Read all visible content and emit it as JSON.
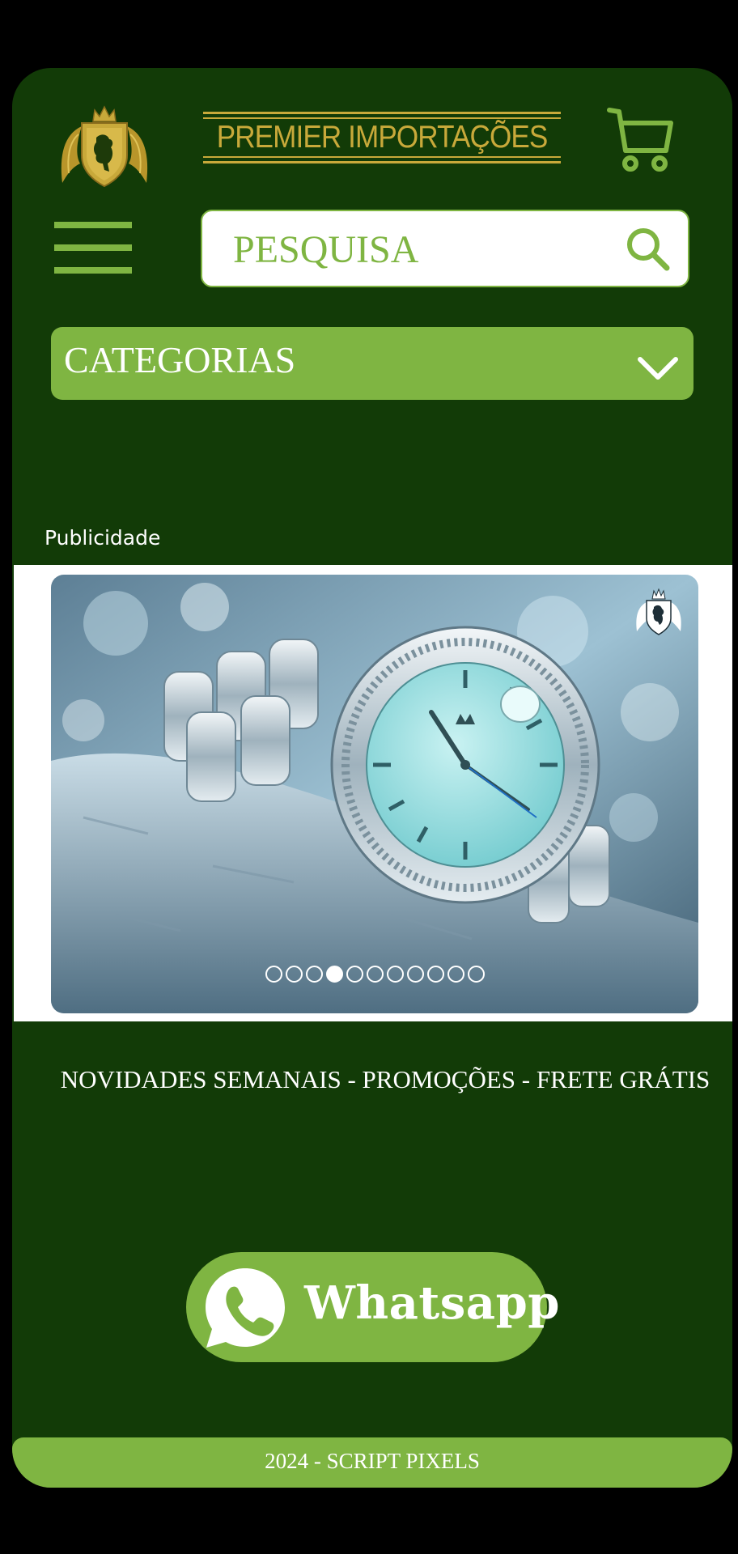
{
  "header": {
    "brand_title": "PREMIER IMPORTAÇÕES"
  },
  "search": {
    "placeholder": "PESQUISA",
    "value": ""
  },
  "categories": {
    "label": "CATEGORIAS"
  },
  "ad": {
    "label": "Publicidade",
    "slide_count": 11,
    "active_slide": 4
  },
  "promo": {
    "text": "NOVIDADES SEMANAIS - PROMOÇÕES - FRETE GRÁTIS"
  },
  "whatsapp": {
    "label": "Whatsapp"
  },
  "footer": {
    "text": "2024 - SCRIPT PIXELS"
  },
  "icons": {
    "logo": "lion-crest-logo",
    "cart": "cart-icon",
    "menu": "hamburger-icon",
    "search": "search-icon",
    "chevron": "chevron-down-icon",
    "whatsapp": "whatsapp-icon"
  },
  "colors": {
    "background": "#123b07",
    "accent_green": "#7fb542",
    "gold": "#c8a93a",
    "text_white": "#ffffff"
  }
}
